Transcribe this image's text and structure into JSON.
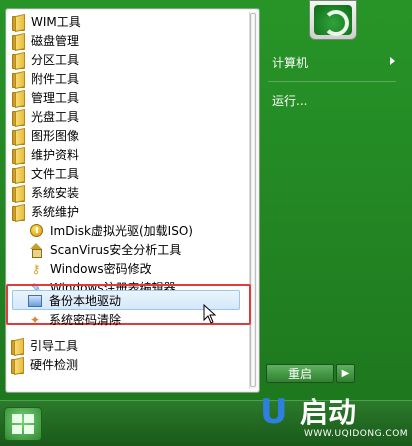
{
  "menu_items": [
    {
      "label": "WIM工具",
      "type": "folder"
    },
    {
      "label": "磁盘管理",
      "type": "folder"
    },
    {
      "label": "分区工具",
      "type": "folder"
    },
    {
      "label": "附件工具",
      "type": "folder"
    },
    {
      "label": "管理工具",
      "type": "folder"
    },
    {
      "label": "光盘工具",
      "type": "folder"
    },
    {
      "label": "图形图像",
      "type": "folder"
    },
    {
      "label": "维护资料",
      "type": "folder"
    },
    {
      "label": "文件工具",
      "type": "folder"
    },
    {
      "label": "系统安装",
      "type": "folder"
    },
    {
      "label": "系统维护",
      "type": "folder"
    }
  ],
  "submenu_items": [
    {
      "label": "ImDisk虚拟光驱(加载ISO)",
      "icon": "disk-icon"
    },
    {
      "label": "ScanVirus安全分析工具",
      "icon": "home-icon"
    },
    {
      "label": "Windows密码修改",
      "icon": "key-icon"
    },
    {
      "label": "Windows注册表编辑器",
      "icon": "registry-icon"
    },
    {
      "label": "备份本地驱动",
      "icon": "driver-backup-icon"
    },
    {
      "label": "系统密码清除",
      "icon": "clean-icon"
    }
  ],
  "bottom_items": [
    {
      "label": "引导工具",
      "type": "folder"
    },
    {
      "label": "硬件检测",
      "type": "folder"
    }
  ],
  "right_panel": {
    "computer": "计算机",
    "run": "运行..."
  },
  "restart_label": "重启",
  "logo": {
    "text": "启动",
    "url": "WWW.UQIDONG.COM"
  }
}
